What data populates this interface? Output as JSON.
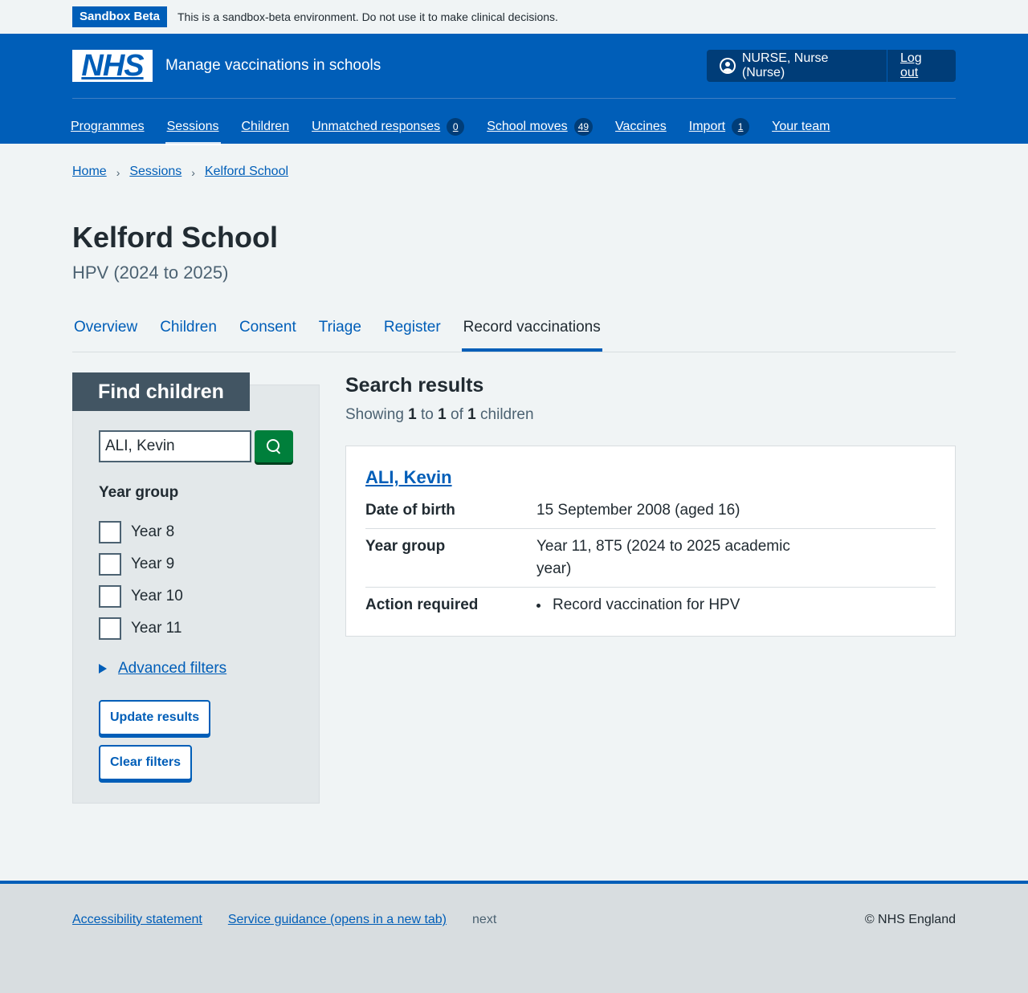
{
  "sandbox": {
    "tag": "Sandbox Beta",
    "message": "This is a sandbox-beta environment. Do not use it to make clinical decisions."
  },
  "header": {
    "logo": "NHS",
    "service_name": "Manage vaccinations in schools",
    "user": "NURSE, Nurse (Nurse)",
    "logout": "Log out",
    "nav": [
      {
        "label": "Programmes"
      },
      {
        "label": "Sessions",
        "current": true
      },
      {
        "label": "Children"
      },
      {
        "label": "Unmatched responses",
        "count": "0"
      },
      {
        "label": "School moves",
        "count": "49"
      },
      {
        "label": "Vaccines"
      },
      {
        "label": "Import",
        "count": "1"
      },
      {
        "label": "Your team"
      }
    ]
  },
  "breadcrumb": [
    "Home",
    "Sessions",
    "Kelford School"
  ],
  "page": {
    "title": "Kelford School",
    "caption": "HPV (2024 to 2025)"
  },
  "tabs": [
    "Overview",
    "Children",
    "Consent",
    "Triage",
    "Register",
    "Record vaccinations"
  ],
  "filters": {
    "heading": "Find children",
    "search_value": "ALI, Kevin",
    "year_group_legend": "Year group",
    "year_groups": [
      "Year 8",
      "Year 9",
      "Year 10",
      "Year 11"
    ],
    "advanced": "Advanced filters",
    "update": "Update results",
    "clear": "Clear filters"
  },
  "results": {
    "heading": "Search results",
    "showing_prefix": "Showing",
    "from": "1",
    "to_word": "to",
    "to": "1",
    "of_word": "of",
    "total": "1",
    "suffix": "children",
    "child": {
      "name": "ALI, Kevin",
      "dob_label": "Date of birth",
      "dob": "15 September 2008 (aged 16)",
      "year_label": "Year group",
      "year": "Year 11, 8T5 (2024 to 2025 academic year)",
      "action_label": "Action required",
      "action": "Record vaccination for HPV"
    }
  },
  "footer": {
    "accessibility": "Accessibility statement",
    "guidance": "Service guidance (opens in a new tab)",
    "next": "next",
    "copyright": "© NHS England"
  },
  "colors": {
    "brand": "#005eb8",
    "green": "#007f3b",
    "panel_head": "#425563"
  }
}
